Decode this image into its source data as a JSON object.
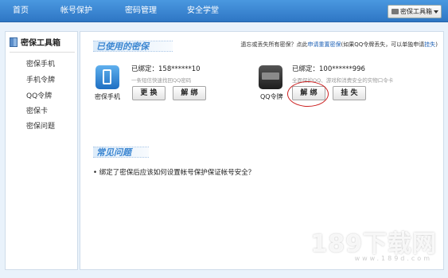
{
  "nav": {
    "items": [
      "首页",
      "帐号保护",
      "密码管理",
      "安全学堂"
    ],
    "toolbox_button": "密保工具箱"
  },
  "sidebar": {
    "title": "密保工具箱",
    "items": [
      "密保手机",
      "手机令牌",
      "QQ令牌",
      "密保卡",
      "密保问题"
    ]
  },
  "used_section": {
    "title": "已使用的密保",
    "notice_prefix": "遗忘或丢失所有密保？点此",
    "notice_link": "申请重置密保",
    "notice_mid": "(如果QQ令牌丢失，可以单独申请",
    "notice_link2": "挂失",
    "notice_suffix": ")"
  },
  "phone": {
    "label": "密保手机",
    "bound": "已绑定：158******10",
    "desc": "一条短信快速找回QQ密码",
    "btn_change": "更 换",
    "btn_unbind": "解 绑"
  },
  "token": {
    "label": "QQ令牌",
    "bound": "已绑定：100******996",
    "desc": "全面保护QQ、游戏和消费安全的实物口令卡",
    "btn_unbind": "解 绑",
    "btn_report": "挂 失"
  },
  "faq_section": {
    "title": "常见问题",
    "items": [
      "• 绑定了密保后应该如何设置帐号保护保证帐号安全？"
    ]
  },
  "watermark": {
    "text": "189下载网",
    "url": "www.189d.com"
  }
}
